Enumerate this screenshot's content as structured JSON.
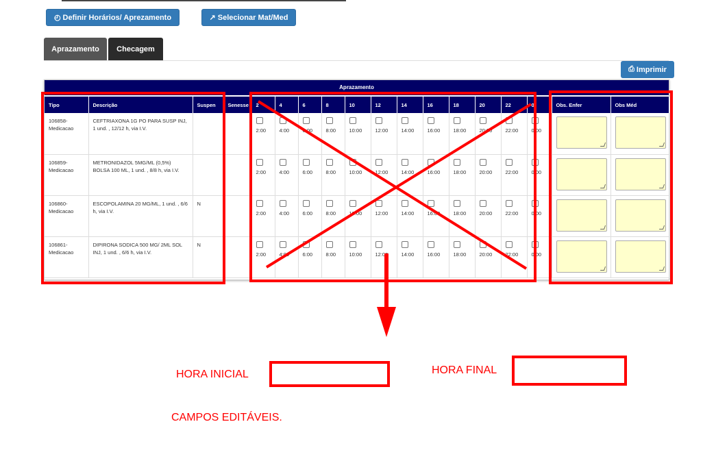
{
  "toolbar": {
    "define_label": "Definir Horários/ Aprezamento",
    "select_label": "Selecionar Mat/Med",
    "print_label": "Imprimir"
  },
  "tabs": [
    {
      "label": "Aprazamento",
      "active": true
    },
    {
      "label": "Checagem",
      "active": false
    }
  ],
  "panel": {
    "title": "Aprazamento",
    "columns": [
      "Tipo",
      "Descrição",
      "Suspen",
      "Senesse",
      "2",
      "4",
      "6",
      "8",
      "10",
      "12",
      "14",
      "16",
      "18",
      "20",
      "22",
      "0",
      "Obs. Enfer",
      "Obs Méd"
    ],
    "time_labels": [
      "2:00",
      "4:00",
      "6:00",
      "8:00",
      "10:00",
      "12:00",
      "14:00",
      "16:00",
      "18:00",
      "20:00",
      "22:00",
      "0:00"
    ],
    "rows": [
      {
        "tipo": "106858-Medicacao",
        "descricao": "CEFTRIAXONA 1G PO PARA SUSP INJ, 1 und. , 12/12 h, via I.V.",
        "suspen": ""
      },
      {
        "tipo": "106859-Medicacao",
        "descricao": "METRONIDAZOL 5MG/ML (0,5%) BOLSA 100 ML, 1 und. , 8/8 h, via I.V.",
        "suspen": ""
      },
      {
        "tipo": "106860-Medicacao",
        "descricao": "ESCOPOLAMINA 20 MG/ML, 1 und. , 6/6 h, via I.V.",
        "suspen": "N"
      },
      {
        "tipo": "106861-Medicacao",
        "descricao": "DIPIRONA SODICA 500 MG/ 2ML SOL INJ, 1 und. , 6/6 h, via I.V.",
        "suspen": "N"
      }
    ]
  },
  "annotations": {
    "hora_inicial": "HORA INICIAL",
    "hora_final": "HORA FINAL",
    "campos": "CAMPOS EDITÁVEIS."
  },
  "colors": {
    "button": "#337ab7",
    "header": "#010066",
    "annotation": "#ff0000",
    "textarea": "#ffffcc"
  },
  "icons": {
    "define": "clock-icon",
    "select": "external-link-icon",
    "print": "printer-icon"
  }
}
